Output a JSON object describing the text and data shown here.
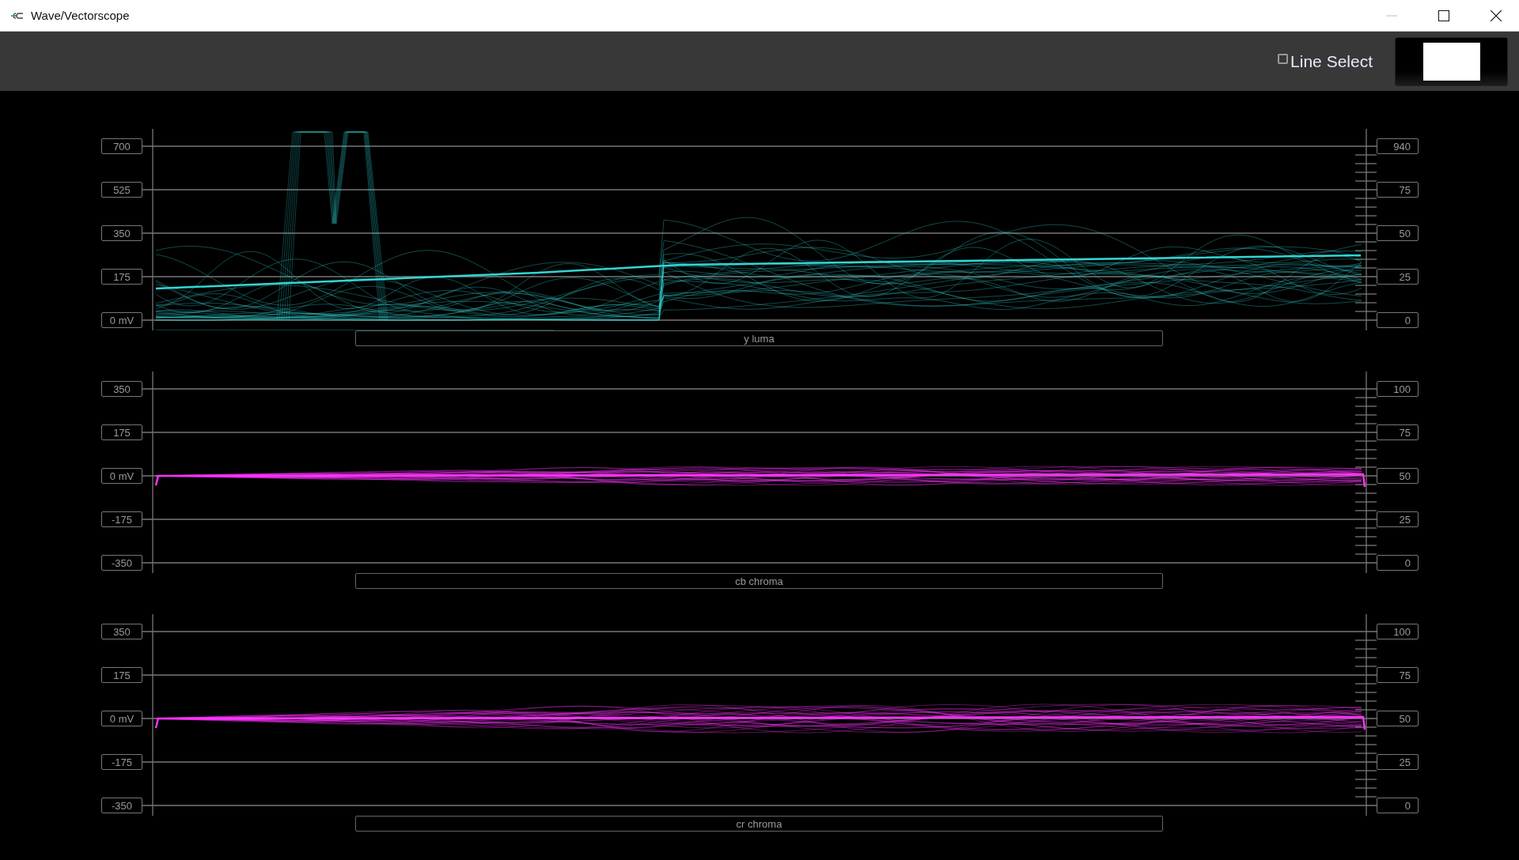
{
  "window": {
    "title": "Wave/Vectorscope"
  },
  "toolbar": {
    "line_select": {
      "label": "Line Select",
      "checked": false
    }
  },
  "panels": [
    {
      "label": "y luma",
      "color": "#33d6d6",
      "left_ticks": [
        "700",
        "525",
        "350",
        "175",
        "0 mV"
      ],
      "right_ticks": [
        "940",
        "75",
        "50",
        "25",
        "0"
      ]
    },
    {
      "label": "cb chroma",
      "color": "#ff33ff",
      "left_ticks": [
        "350",
        "175",
        "0 mV",
        "-175",
        "-350"
      ],
      "right_ticks": [
        "100",
        "75",
        "50",
        "25",
        "0"
      ]
    },
    {
      "label": "cr chroma",
      "color": "#ff33ff",
      "left_ticks": [
        "350",
        "175",
        "0 mV",
        "-175",
        "-350"
      ],
      "right_ticks": [
        "100",
        "75",
        "50",
        "25",
        "0"
      ]
    }
  ]
}
